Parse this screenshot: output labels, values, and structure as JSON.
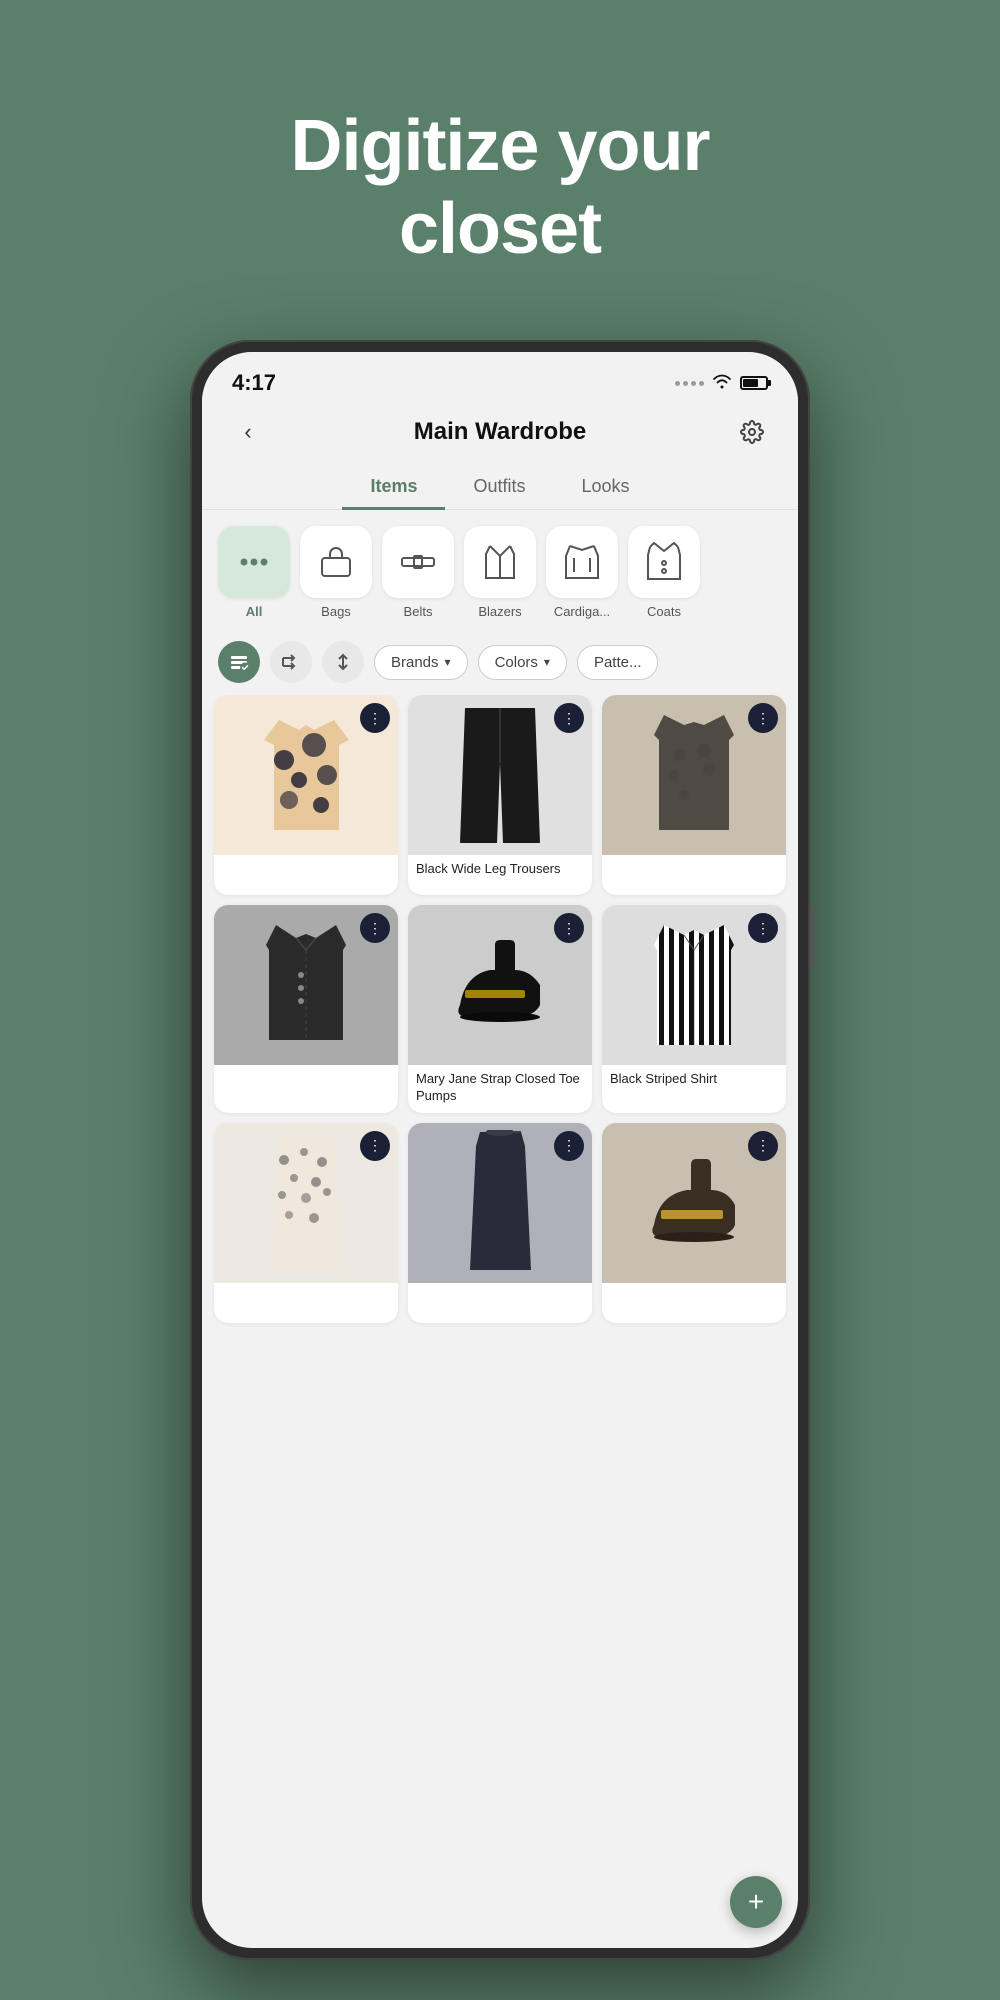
{
  "hero": {
    "line1": "Digitize your",
    "line2": "closet"
  },
  "status_bar": {
    "time": "4:17"
  },
  "header": {
    "title": "Main Wardrobe",
    "back_label": "‹",
    "settings_label": "⚙"
  },
  "tabs": [
    {
      "label": "Items",
      "active": true
    },
    {
      "label": "Outfits",
      "active": false
    },
    {
      "label": "Looks",
      "active": false
    }
  ],
  "categories": [
    {
      "label": "All",
      "icon": "···",
      "active": true
    },
    {
      "label": "Bags",
      "icon": "👜",
      "active": false
    },
    {
      "label": "Belts",
      "icon": "👔",
      "active": false
    },
    {
      "label": "Blazers",
      "icon": "🧥",
      "active": false
    },
    {
      "label": "Cardiga...",
      "icon": "🧶",
      "active": false
    },
    {
      "label": "Coats",
      "icon": "🧥",
      "active": false
    }
  ],
  "filters": {
    "brands_label": "Brands",
    "colors_label": "Colors",
    "patterns_label": "Patte..."
  },
  "items": [
    {
      "id": 1,
      "label": "",
      "bg": "floral",
      "emoji": "🌸"
    },
    {
      "id": 2,
      "label": "Black Wide Leg Trousers",
      "bg": "dark",
      "emoji": "👖"
    },
    {
      "id": 3,
      "label": "",
      "bg": "taupe",
      "emoji": "🧥"
    },
    {
      "id": 4,
      "label": "",
      "bg": "charcoal",
      "emoji": "🧥"
    },
    {
      "id": 5,
      "label": "Mary Jane Strap Closed Toe Pumps",
      "bg": "black2",
      "emoji": "👠"
    },
    {
      "id": 6,
      "label": "Black Striped Shirt",
      "bg": "striped",
      "emoji": "👕"
    },
    {
      "id": 7,
      "label": "",
      "bg": "floral2",
      "emoji": "👗"
    },
    {
      "id": 8,
      "label": "",
      "bg": "navy",
      "emoji": "👗"
    },
    {
      "id": 9,
      "label": "",
      "bg": "shoe2",
      "emoji": "👠"
    }
  ],
  "fab_label": "+"
}
